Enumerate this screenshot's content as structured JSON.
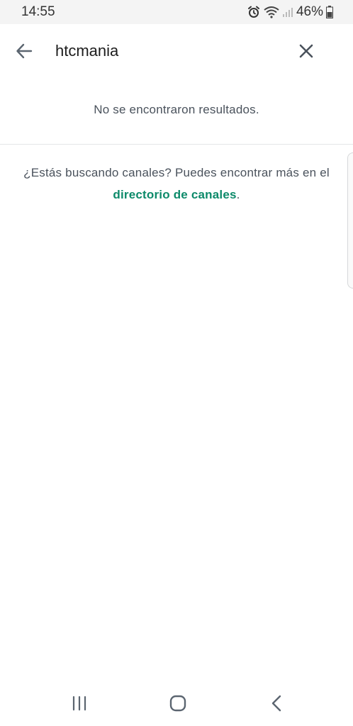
{
  "status_bar": {
    "time": "14:55",
    "battery": "46%",
    "icons": [
      "alarm-icon",
      "wifi-icon",
      "signal-icon",
      "battery-icon"
    ]
  },
  "search": {
    "query": "htcmania",
    "back_icon": "arrow-left-icon",
    "clear_icon": "close-icon"
  },
  "results": {
    "empty_message": "No se encontraron resultados."
  },
  "channel_hint": {
    "text_before": "¿Estás buscando canales? Puedes encontrar más en el ",
    "link_text": "directorio de canales",
    "text_after": "."
  },
  "nav_bar": {
    "icons": [
      "recent-apps-icon",
      "home-icon",
      "back-icon"
    ]
  },
  "colors": {
    "accent": "#0d8a6a",
    "text": "#4a525c",
    "icon": "#5b6570"
  }
}
